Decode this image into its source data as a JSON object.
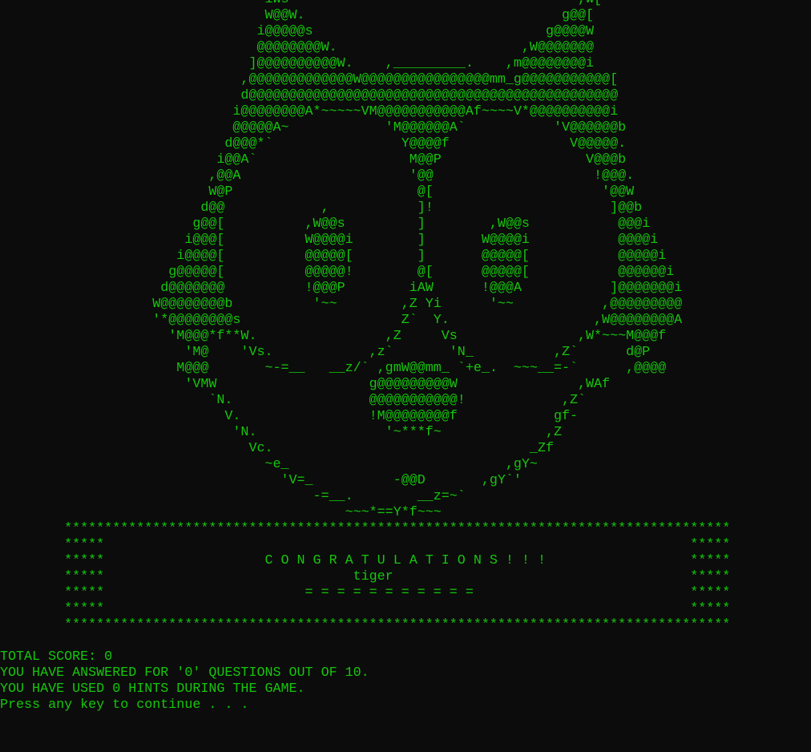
{
  "terminal": {
    "art_lines": [
      "                                 iWs                                    ,W[",
      "                                 W@@W.                                g@@[",
      "                                i@@@@@s                             g@@@@W",
      "                                @@@@@@@@W.                       ,W@@@@@@@",
      "                               ]@@@@@@@@@@W.    ,_________.    ,m@@@@@@@@i",
      "                              ,@@@@@@@@@@@@@W@@@@@@@@@@@@@@@@mm_g@@@@@@@@@@@[",
      "                              d@@@@@@@@@@@@@@@@@@@@@@@@@@@@@@@@@@@@@@@@@@@@@@",
      "                             i@@@@@@@@A*~~~~~VM@@@@@@@@@@@Af~~~~V*@@@@@@@@@@i",
      "                             @@@@@A~            'M@@@@@@A`           'V@@@@@@b",
      "                            d@@@*`                Y@@@@f               V@@@@@.",
      "                           i@@A`                   M@@P                  V@@@b",
      "                          ,@@A                     '@@                    !@@@.",
      "                          W@P                       @[                     '@@W",
      "                         d@@            ,           ]!                      ]@@b",
      "                        g@@[          ,W@@s         ]        ,W@@s           @@@i",
      "                       i@@@[          W@@@@i        ]       W@@@@i           @@@@i",
      "                      i@@@@[          @@@@@[        ]       @@@@@[           @@@@@i",
      "                     g@@@@@[          @@@@@!        @[      @@@@@[           @@@@@@i",
      "                    d@@@@@@@          !@@@P        iAW      !@@@A           ]@@@@@@@i",
      "                   W@@@@@@@@b          '~~        ,Z Yi      '~~           ,@@@@@@@@@",
      "                   '*@@@@@@@@s                    Z`  Y.                  ,W@@@@@@@@A",
      "                     'M@@@*f**W.                ,Z     Vs               ,W*~~~M@@@f",
      "                       'M@    'Vs.            ,z`       'N_          ,Z`      d@P",
      "                      M@@@       ~-=__   __z/` ,gmW@@mm_ `+e_.  ~~~__=-`      ,@@@@",
      "                       'VMW                   g@@@@@@@@@W               ,WAf",
      "                          `N.                 @@@@@@@@@@@!            ,Z`",
      "                            V.                !M@@@@@@@@f            gf-",
      "                             'N.                '~***f~             ,Z",
      "                               Vc.                                _Zf",
      "                                 ~e_                           ,gY~",
      "                                   'V=_          -@@D       ,gY`'",
      "                                       -=__.        __z=~`",
      "                                           ~~~*==Y*f~~~"
    ],
    "banner_lines": [
      "        ***********************************************************************************",
      "        *****                                                                         *****",
      "        *****                    C O N G R A T U L A T I O N S ! ! !                  *****",
      "        *****                               tiger                                     *****",
      "        *****                         = = = = = = = = = = =                           *****",
      "        *****                                                                         *****",
      "        ***********************************************************************************"
    ],
    "blank_line": " ",
    "score_line": "TOTAL SCORE: 0",
    "answered_line": "YOU HAVE ANSWERED FOR '0' QUESTIONS OUT OF 10.",
    "hints_line": "YOU HAVE USED 0 HINTS DURING THE GAME.",
    "prompt_line": "Press any key to continue . . ."
  }
}
